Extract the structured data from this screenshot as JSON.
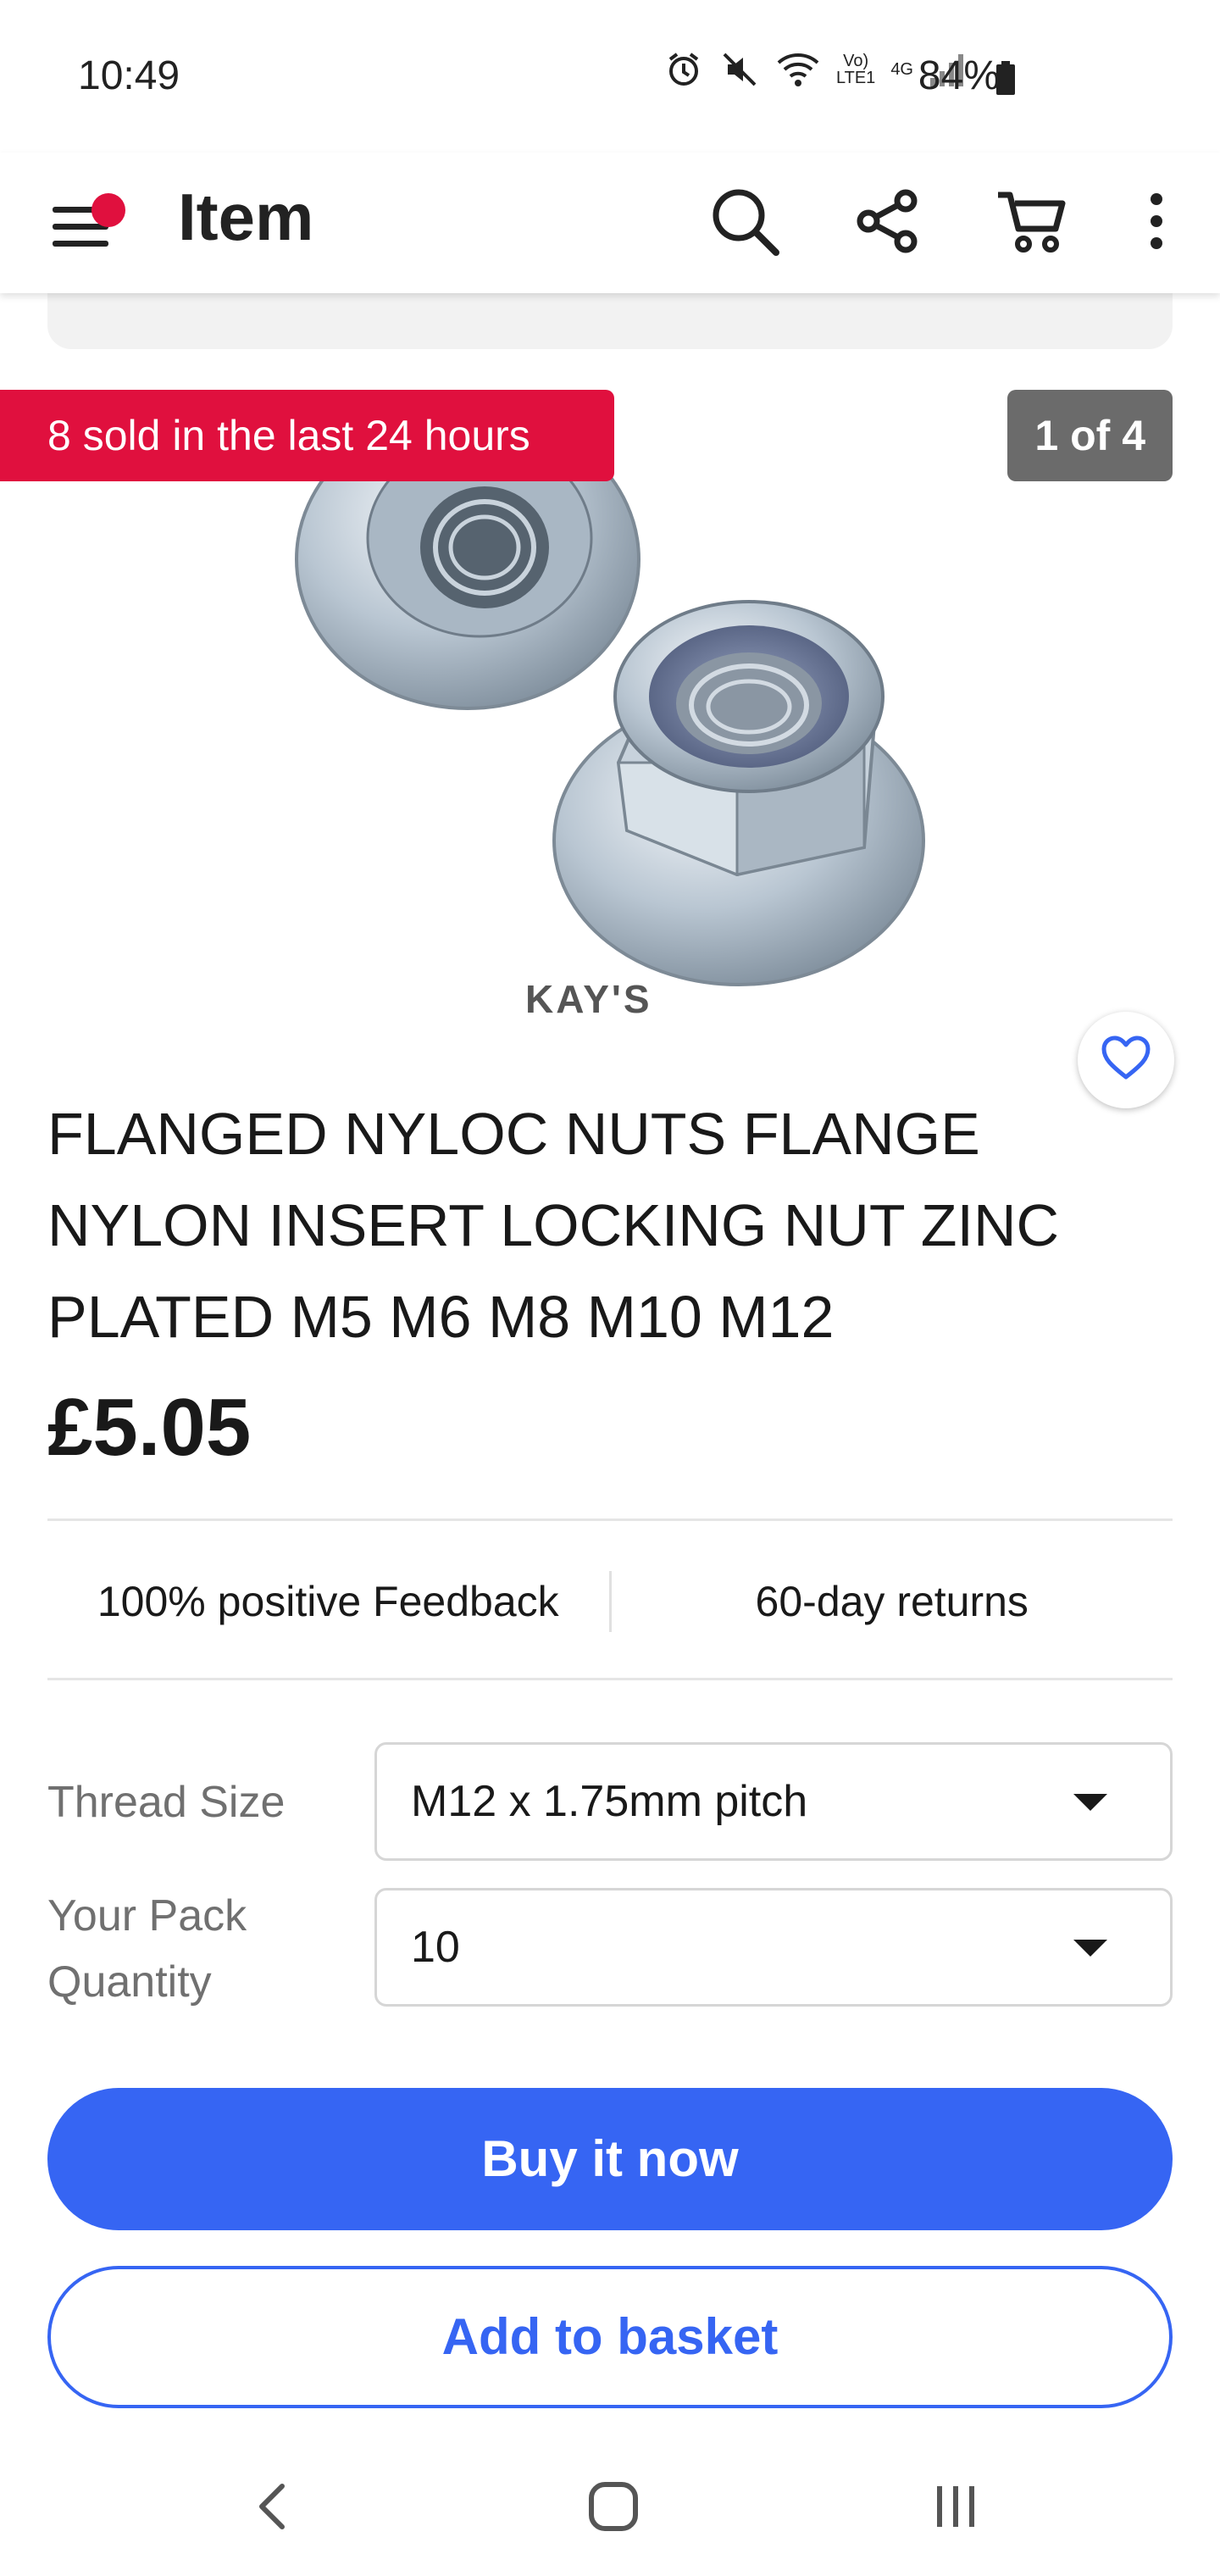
{
  "status_bar": {
    "time": "10:49",
    "network_top": "Vo)",
    "network_bottom": "LTE1",
    "data_type": "4G",
    "battery": "84%"
  },
  "app_bar": {
    "title": "Item",
    "icons": [
      "menu-icon",
      "search-icon",
      "share-icon",
      "cart-icon",
      "more-vert-icon"
    ],
    "menu_badge_color": "#e0103e"
  },
  "gallery": {
    "sold_banner": "8 sold in the last 24 hours",
    "counter": "1 of 4",
    "brand_mark": "KAY'S",
    "watermark_small": "KAY'S"
  },
  "product": {
    "title": "FLANGED NYLOC NUTS FLANGE NYLON INSERT LOCKING NUT ZINC PLATED M5 M6 M8 M10 M12",
    "price": "£5.05"
  },
  "highlights": {
    "feedback": "100% positive Feedback",
    "returns": "60-day returns"
  },
  "variations": {
    "thread_size": {
      "label": "Thread Size",
      "value": "M12 x 1.75mm pitch"
    },
    "pack_quantity": {
      "label_line1": "Your Pack",
      "label_line2": "Quantity",
      "value": "10"
    }
  },
  "actions": {
    "buy_now": "Buy it now",
    "add_to_basket": "Add to basket"
  },
  "colors": {
    "accent": "#3665f3",
    "sold_banner": "#e0103e",
    "counter_bg": "#6b6b6b"
  },
  "nav_bar": {
    "icons": [
      "back-icon",
      "home-icon",
      "recents-icon"
    ]
  }
}
